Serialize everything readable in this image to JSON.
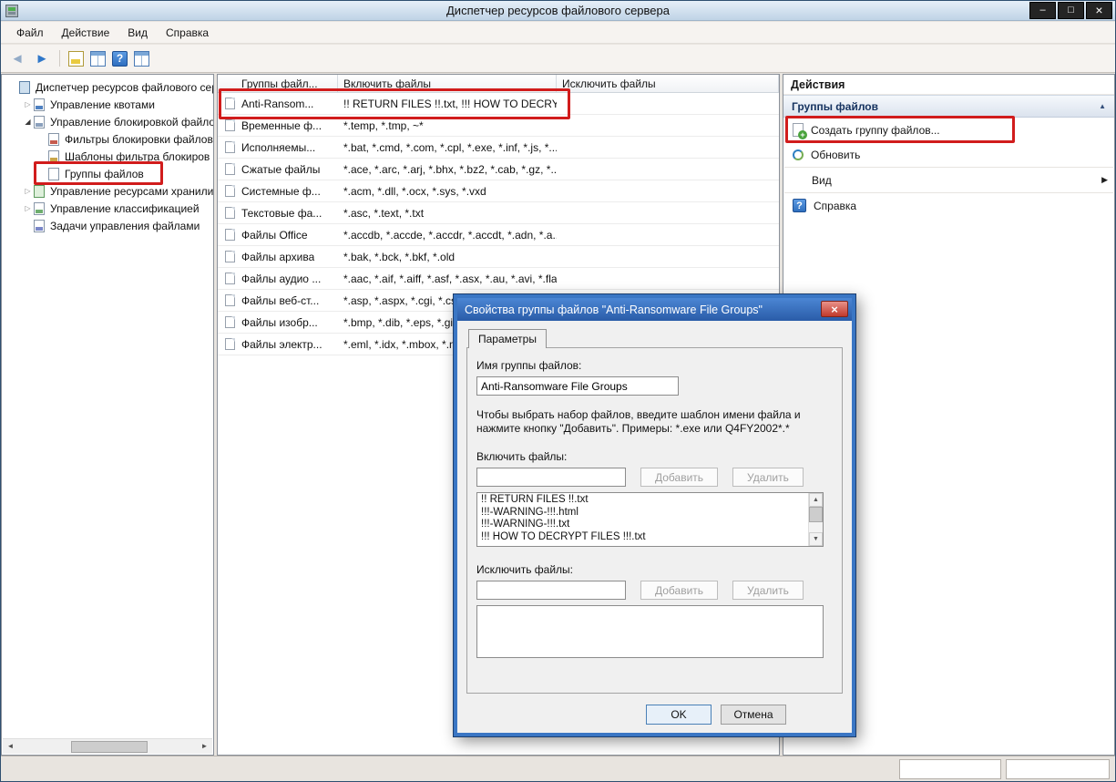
{
  "window": {
    "title": "Диспетчер ресурсов файлового сервера",
    "controls": [
      "minimize",
      "maximize",
      "close"
    ]
  },
  "menubar": {
    "items": [
      "Файл",
      "Действие",
      "Вид",
      "Справка"
    ]
  },
  "tree": {
    "items": [
      {
        "label": "Диспетчер ресурсов файлового сер",
        "level": 0,
        "expander": "none",
        "icon": "console"
      },
      {
        "label": "Управление квотами",
        "level": 1,
        "expander": "collapsed",
        "icon": "quota"
      },
      {
        "label": "Управление блокировкой файло",
        "level": 1,
        "expander": "expanded",
        "icon": "screening"
      },
      {
        "label": "Фильтры блокировки файлов",
        "level": 2,
        "expander": "none",
        "icon": "filter"
      },
      {
        "label": "Шаблоны фильтра блокиров",
        "level": 2,
        "expander": "none",
        "icon": "template"
      },
      {
        "label": "Группы файлов",
        "level": 2,
        "expander": "none",
        "icon": "filegroup"
      },
      {
        "label": "Управление ресурсами хранили",
        "level": 1,
        "expander": "collapsed",
        "icon": "storage"
      },
      {
        "label": "Управление классификацией",
        "level": 1,
        "expander": "collapsed",
        "icon": "classification"
      },
      {
        "label": "Задачи управления файлами",
        "level": 1,
        "expander": "none",
        "icon": "tasks"
      }
    ]
  },
  "filelist": {
    "columns": [
      "Группы файл...",
      "Включить файлы",
      "Исключить файлы"
    ],
    "rows": [
      {
        "name": "Anti-Ransom...",
        "include": "!! RETURN FILES !!.txt, !!! HOW TO DECRYP...",
        "exclude": ""
      },
      {
        "name": "Временные ф...",
        "include": "*.temp, *.tmp, ~*",
        "exclude": ""
      },
      {
        "name": "Исполняемы...",
        "include": "*.bat, *.cmd, *.com, *.cpl, *.exe, *.inf, *.js, *....",
        "exclude": ""
      },
      {
        "name": "Сжатые файлы",
        "include": "*.ace, *.arc, *.arj, *.bhx, *.bz2, *.cab, *.gz, *....",
        "exclude": ""
      },
      {
        "name": "Системные ф...",
        "include": "*.acm, *.dll, *.ocx, *.sys, *.vxd",
        "exclude": ""
      },
      {
        "name": "Текстовые фа...",
        "include": "*.asc, *.text, *.txt",
        "exclude": ""
      },
      {
        "name": "Файлы Office",
        "include": "*.accdb, *.accde, *.accdr, *.accdt, *.adn, *.a...",
        "exclude": ""
      },
      {
        "name": "Файлы архива",
        "include": "*.bak, *.bck, *.bkf, *.old",
        "exclude": ""
      },
      {
        "name": "Файлы аудио ...",
        "include": "*.aac, *.aif, *.aiff, *.asf, *.asx, *.au, *.avi, *.fla...",
        "exclude": ""
      },
      {
        "name": "Файлы веб-ст...",
        "include": "*.asp, *.aspx, *.cgi, *.css,...",
        "exclude": ""
      },
      {
        "name": "Файлы изобр...",
        "include": "*.bmp, *.dib, *.eps, *.gif,...",
        "exclude": ""
      },
      {
        "name": "Файлы электр...",
        "include": "*.eml, *.idx, *.mbox, *.m...",
        "exclude": ""
      }
    ]
  },
  "actions": {
    "title": "Действия",
    "group": "Группы файлов",
    "items": [
      {
        "label": "Создать группу файлов...",
        "icon": "create-file-group"
      },
      {
        "label": "Обновить",
        "icon": "refresh"
      },
      {
        "label": "Вид",
        "icon": "none",
        "submenu": true
      },
      {
        "label": "Справка",
        "icon": "help"
      }
    ]
  },
  "dialog": {
    "title": "Свойства группы файлов \"Anti-Ransomware File Groups\"",
    "tab": "Параметры",
    "name_label": "Имя группы файлов:",
    "name_value": "Anti-Ransomware File Groups",
    "help_text": "Чтобы выбрать набор файлов, введите шаблон имени файла и нажмите кнопку \"Добавить\". Примеры: *.exe или Q4FY2002*.*",
    "include_label": "Включить файлы:",
    "exclude_label": "Исключить файлы:",
    "add_label": "Добавить",
    "remove_label": "Удалить",
    "include_items": [
      "!! RETURN FILES !!.txt",
      "!!!-WARNING-!!!.html",
      "!!!-WARNING-!!!.txt",
      "!!! HOW TO DECRYPT FILES !!!.txt"
    ],
    "ok_label": "OK",
    "cancel_label": "Отмена"
  },
  "colors": {
    "annotation_red": "#d11c1c",
    "dialog_titlebar": "#2a5ca8",
    "dialog_border": "#3a76c4",
    "titlebar": "#bfd3e6"
  }
}
